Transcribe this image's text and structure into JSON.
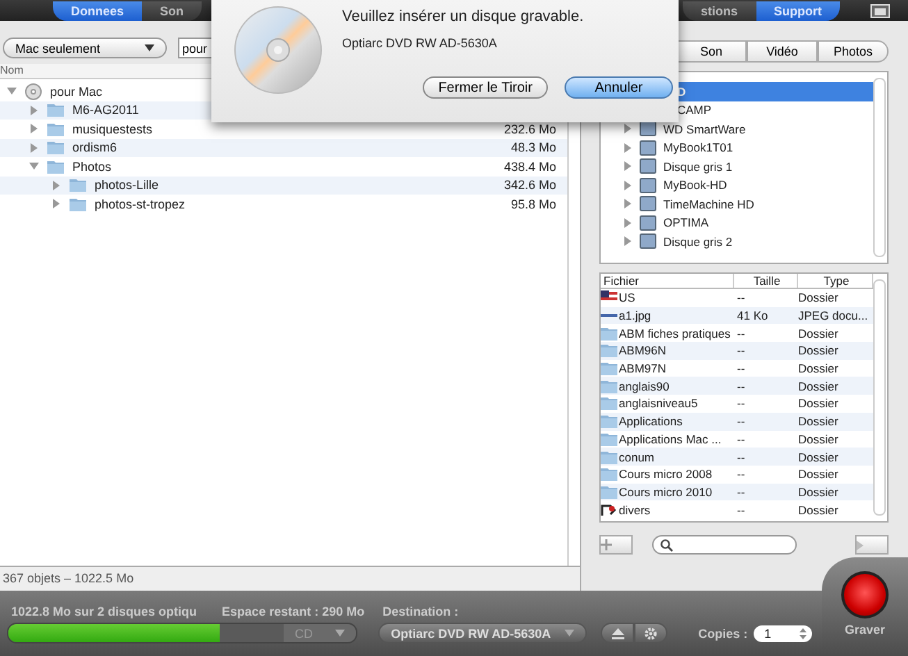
{
  "toolbar": {
    "tabs": [
      {
        "label": "Donnees",
        "selected": true
      },
      {
        "label": "Son",
        "selected": false
      },
      {
        "label": "stions",
        "selected": false
      },
      {
        "label": "Support",
        "selected": true
      }
    ]
  },
  "dialog": {
    "title": "Veuillez insérer un disque gravable.",
    "device": "Optiarc DVD RW AD-5630A",
    "buttons": [
      {
        "label": "Fermer le Tiroir",
        "default": false
      },
      {
        "label": "Annuler",
        "default": true
      }
    ]
  },
  "left_panel": {
    "filter": "Mac seulement",
    "search": {
      "value": "pour"
    },
    "column": "Nom",
    "tree": [
      {
        "name": "pour Mac",
        "kind": "disk",
        "expanded": true,
        "children": [
          {
            "name": "M6-AG2011",
            "kind": "folder",
            "expanded": false
          },
          {
            "name": "musiquestests",
            "kind": "folder",
            "expanded": false,
            "size": "232.6 Mo"
          },
          {
            "name": "ordism6",
            "kind": "folder",
            "expanded": false,
            "size": "48.3 Mo"
          },
          {
            "name": "Photos",
            "kind": "folder",
            "expanded": true,
            "size": "438.4 Mo",
            "children": [
              {
                "name": "photos-Lille",
                "kind": "folder",
                "expanded": false,
                "size": "342.6 Mo"
              },
              {
                "name": "photos-st-tropez",
                "kind": "folder",
                "expanded": false,
                "size": "95.8 Mo"
              }
            ]
          }
        ]
      }
    ],
    "status": "367 objets – 1022.5 Mo"
  },
  "right_panel": {
    "media_tabs": [
      {
        "label": "Son",
        "selected": false
      },
      {
        "label": "Vidéo",
        "selected": false
      },
      {
        "label": "Photos",
        "selected": false
      }
    ],
    "devices": [
      {
        "name": "D",
        "kind": "partial",
        "selected": true
      },
      {
        "name": "CAMP",
        "kind": "partial",
        "selected": false
      },
      {
        "name": "WD SmartWare",
        "kind": "full",
        "selected": false,
        "expanded": false
      },
      {
        "name": "MyBook1T01",
        "kind": "full",
        "selected": false,
        "expanded": false
      },
      {
        "name": "Disque gris 1",
        "kind": "full",
        "selected": false,
        "expanded": false
      },
      {
        "name": "MyBook-HD",
        "kind": "full",
        "selected": false,
        "expanded": false
      },
      {
        "name": "TimeMachine HD",
        "kind": "full",
        "selected": false,
        "expanded": false
      },
      {
        "name": "OPTIMA",
        "kind": "full",
        "selected": false,
        "expanded": false
      },
      {
        "name": "Disque gris 2",
        "kind": "full",
        "selected": false,
        "expanded": false
      }
    ],
    "files": {
      "columns": [
        "Fichier",
        "Taille",
        "Type"
      ],
      "rows": [
        {
          "name": "US",
          "size": "--",
          "type": "Dossier",
          "kind": "flag"
        },
        {
          "name": "a1.jpg",
          "size": "41 Ko",
          "type": "JPEG docu...",
          "kind": "image"
        },
        {
          "name": "ABM fiches pratiques",
          "size": "--",
          "type": "Dossier",
          "kind": "folder"
        },
        {
          "name": "ABM96N",
          "size": "--",
          "type": "Dossier",
          "kind": "folder"
        },
        {
          "name": "ABM97N",
          "size": "--",
          "type": "Dossier",
          "kind": "folder"
        },
        {
          "name": "anglais90",
          "size": "--",
          "type": "Dossier",
          "kind": "folder"
        },
        {
          "name": "anglaisniveau5",
          "size": "--",
          "type": "Dossier",
          "kind": "folder"
        },
        {
          "name": "Applications",
          "size": "--",
          "type": "Dossier",
          "kind": "folder"
        },
        {
          "name": "Applications Mac ...",
          "size": "--",
          "type": "Dossier",
          "kind": "folder"
        },
        {
          "name": "conum",
          "size": "--",
          "type": "Dossier",
          "kind": "folder"
        },
        {
          "name": "Cours micro 2008",
          "size": "--",
          "type": "Dossier",
          "kind": "folder"
        },
        {
          "name": "Cours micro 2010",
          "size": "--",
          "type": "Dossier",
          "kind": "folder"
        },
        {
          "name": "divers",
          "size": "--",
          "type": "Dossier",
          "kind": "alias"
        }
      ]
    }
  },
  "burn_bar": {
    "usage": "1022.8 Mo sur 2 disques optiqu",
    "remaining": "Espace restant : 290 Mo",
    "level": 0.77,
    "media": "CD",
    "destination_label": "Destination :",
    "destination": "Optiarc DVD RW AD-5630A",
    "copies_label": "Copies :",
    "copies": "1",
    "burn_label": "Graver"
  }
}
